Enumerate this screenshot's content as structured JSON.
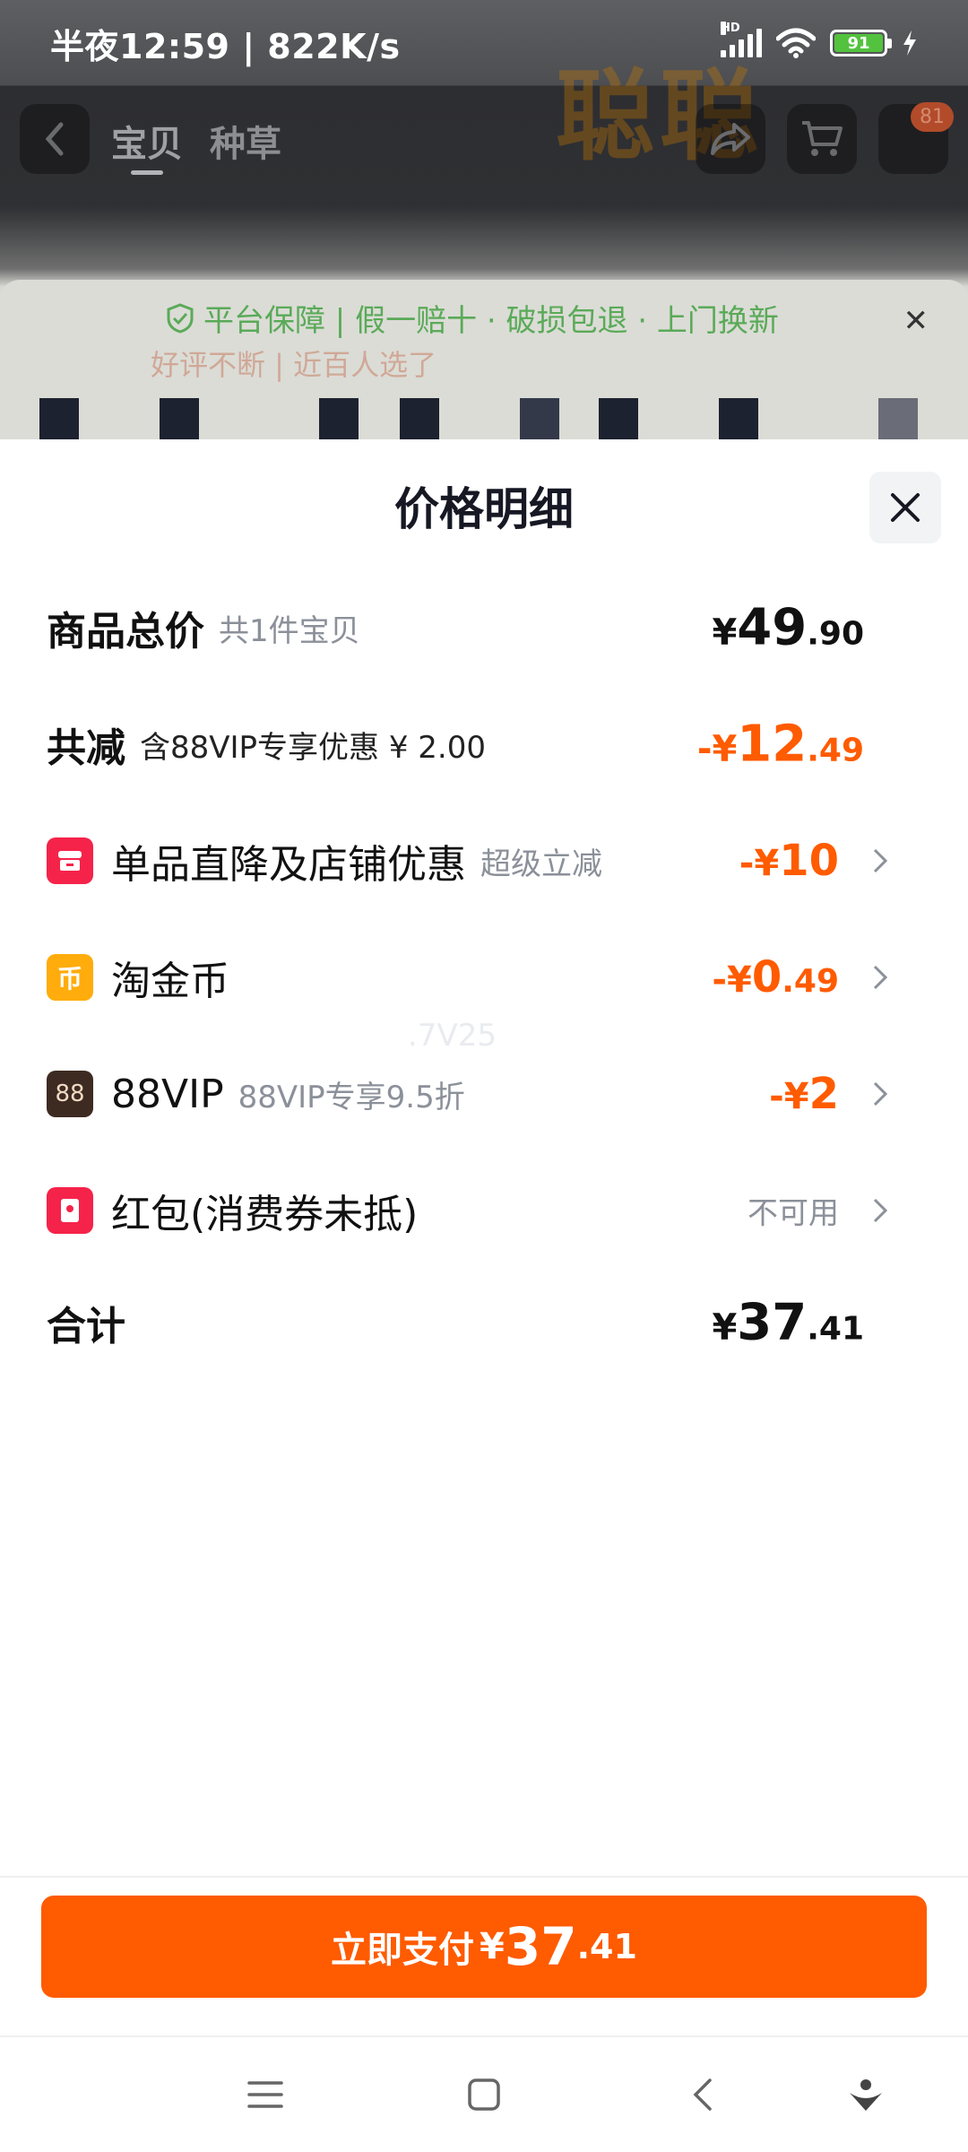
{
  "status_bar": {
    "time_speed": "半夜12:59 | 822K/s",
    "network": "HD",
    "battery": "91"
  },
  "nav": {
    "tabs": [
      "宝贝",
      "种草"
    ],
    "cart_badge": "81"
  },
  "guarantee": {
    "text": "平台保障 | 假一赔十 · 破损包退 · 上门换新",
    "sub": "好评不断 | 近百人选了"
  },
  "sheet": {
    "title": "价格明细",
    "rows": [
      {
        "label": "商品总价",
        "sub": "共1件宝贝",
        "yen": "¥",
        "int": "49",
        "dec": ".90"
      },
      {
        "label": "共减",
        "sub": "含88VIP专享优惠 ¥ 2.00",
        "yen": "-¥",
        "int": "12",
        "dec": ".49"
      },
      {
        "label": "单品直降及店铺优惠",
        "sub": "超级立减",
        "yen": "-¥",
        "int": "10",
        "dec": ""
      },
      {
        "label": "淘金币",
        "sub": "",
        "yen": "-¥",
        "int": "0",
        "dec": ".49"
      },
      {
        "label": "88VIP",
        "sub": "88VIP专享9.5折",
        "yen": "-¥",
        "int": "2",
        "dec": ""
      },
      {
        "label": "红包(消费券未抵)",
        "sub": "",
        "status": "不可用"
      },
      {
        "label": "合计",
        "sub": "",
        "yen": "¥",
        "int": "37",
        "dec": ".41"
      }
    ],
    "ghost_text": ".7V25"
  },
  "pay_button": {
    "label": "立即支付",
    "yen": "¥",
    "int": "37",
    "dec": ".41"
  },
  "colors": {
    "accent": "#ff5b00",
    "shop_icon": "#f5234a",
    "coin_icon": "#ffac0c",
    "vip_icon": "#3d2b22",
    "redpacket_icon": "#f5234a"
  },
  "icons": {
    "shop": "shop-discount-icon",
    "coin": "taojinbi-coin-icon",
    "vip": "88vip-icon",
    "redpacket": "red-packet-icon"
  }
}
